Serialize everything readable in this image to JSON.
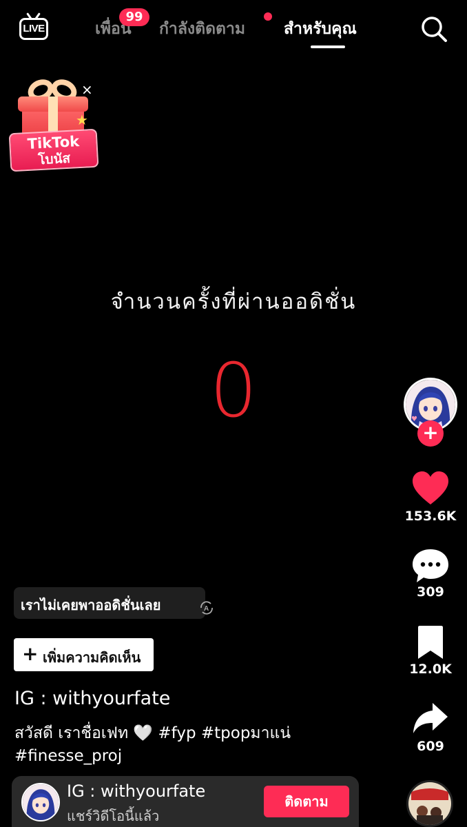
{
  "nav": {
    "live_label": "LIVE",
    "tabs": [
      {
        "label": "เพื่อน",
        "badge": "99"
      },
      {
        "label": "กำลังติดตาม",
        "has_dot": true
      },
      {
        "label": "สำหรับคุณ",
        "active": true
      }
    ]
  },
  "bonus": {
    "line1": "TikTok",
    "line2": "โบนัส",
    "close": "×"
  },
  "video": {
    "headline": "จำนวนครั้งที่ผ่านออดิชั่น",
    "counter": "0",
    "counter_color": "#e8272f"
  },
  "rail": {
    "likes": "153.6K",
    "comments": "309",
    "saves": "12.0K",
    "shares": "609"
  },
  "caption_area": {
    "sound_chip": "เราไม่เคยพาออดิชั่นเลย",
    "add_comment": "เพิ่มความคิดเห็น",
    "username": "IG : withyourfate",
    "caption_text": "สวัสดี เราชื่อเฟท ",
    "caption_heart": "🤍",
    "caption_tags": " #fyp #tpopมาแน่",
    "caption_line2": "#finesse_proj"
  },
  "banner": {
    "name": "IG : withyourfate",
    "subtitle": "แชร์วิดีโอนี้แล้ว",
    "follow_label": "ติดตาม"
  },
  "colors": {
    "accent": "#fe2c55",
    "background": "#000000"
  }
}
